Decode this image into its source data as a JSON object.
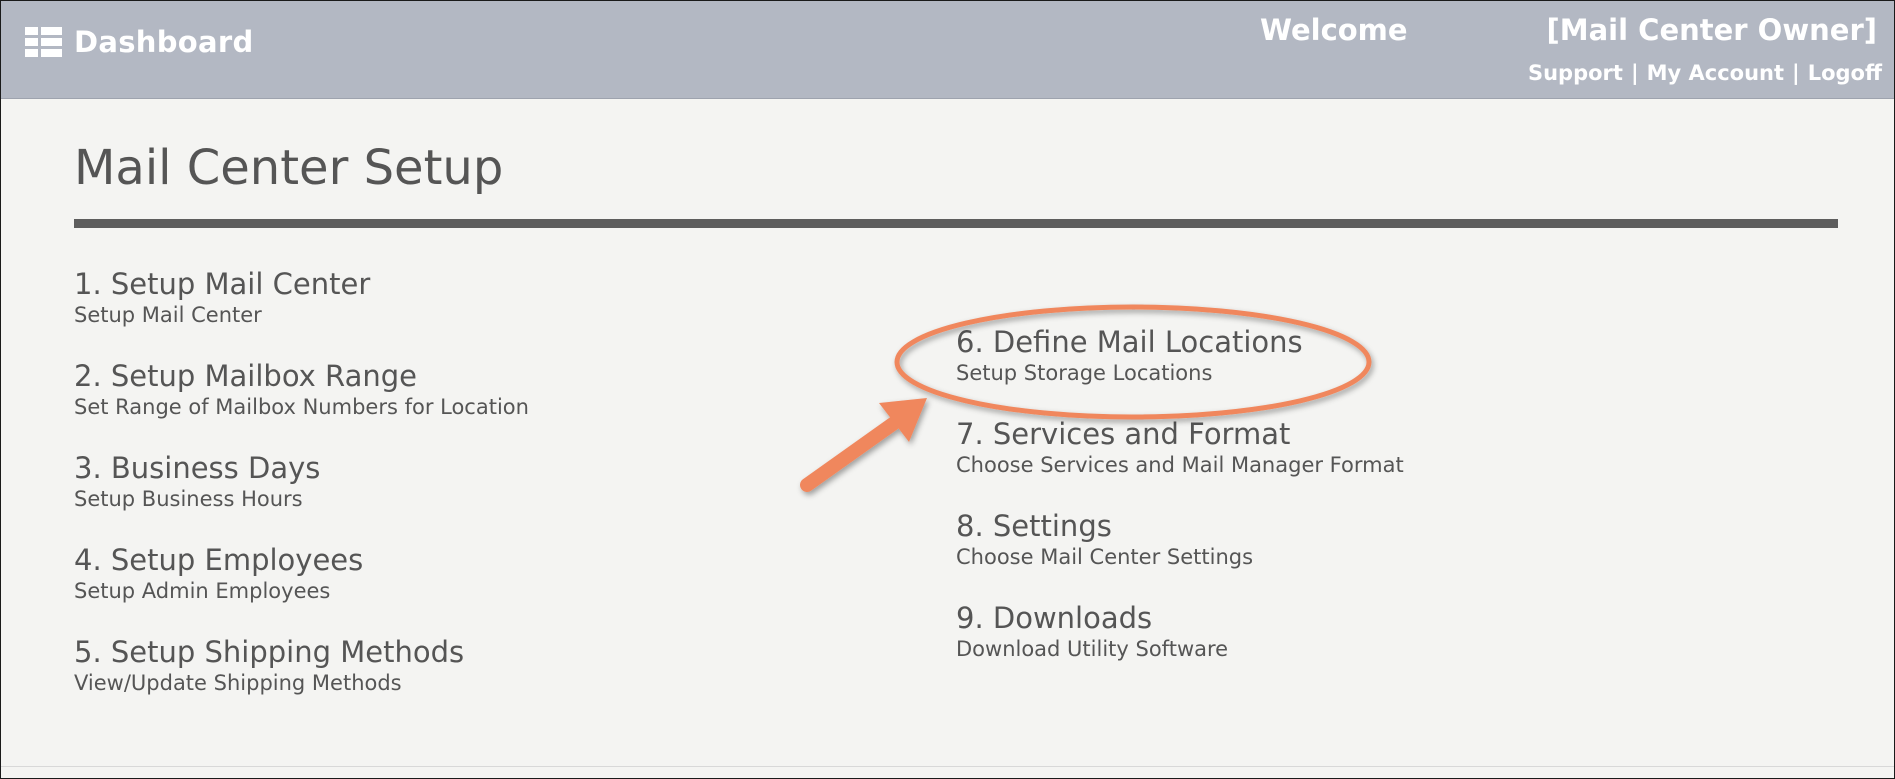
{
  "header": {
    "dashboard_label": "Dashboard",
    "welcome": "Welcome",
    "user": "[Mail Center Owner]",
    "links": {
      "support": "Support",
      "separator": "|",
      "my_account": "My Account",
      "logoff": "Logoff"
    }
  },
  "page": {
    "title": "Mail Center Setup"
  },
  "setup_items": [
    {
      "title": "1. Setup Mail Center",
      "subtitle": "Setup Mail Center"
    },
    {
      "title": "2. Setup Mailbox Range",
      "subtitle": "Set Range of Mailbox Numbers for Location"
    },
    {
      "title": "3. Business Days",
      "subtitle": "Setup Business Hours"
    },
    {
      "title": "4. Setup Employees",
      "subtitle": "Setup Admin Employees"
    },
    {
      "title": "5. Setup Shipping Methods",
      "subtitle": "View/Update Shipping Methods"
    },
    {
      "title": "6. Define Mail Locations",
      "subtitle": "Setup Storage Locations"
    },
    {
      "title": "7. Services and Format",
      "subtitle": "Choose Services and Mail Manager Format"
    },
    {
      "title": "8. Settings",
      "subtitle": "Choose Mail Center Settings"
    },
    {
      "title": "9. Downloads",
      "subtitle": "Download Utility Software"
    }
  ],
  "colors": {
    "header_bg": "#b3b8c3",
    "page_bg": "#f4f4f2",
    "text": "#555555",
    "rule": "#5d5d5d",
    "highlight": "#f0875d"
  },
  "annotation": {
    "highlighted_item": "6. Define Mail Locations",
    "shapes": [
      "ellipse-highlight",
      "arrow-pointer"
    ]
  }
}
